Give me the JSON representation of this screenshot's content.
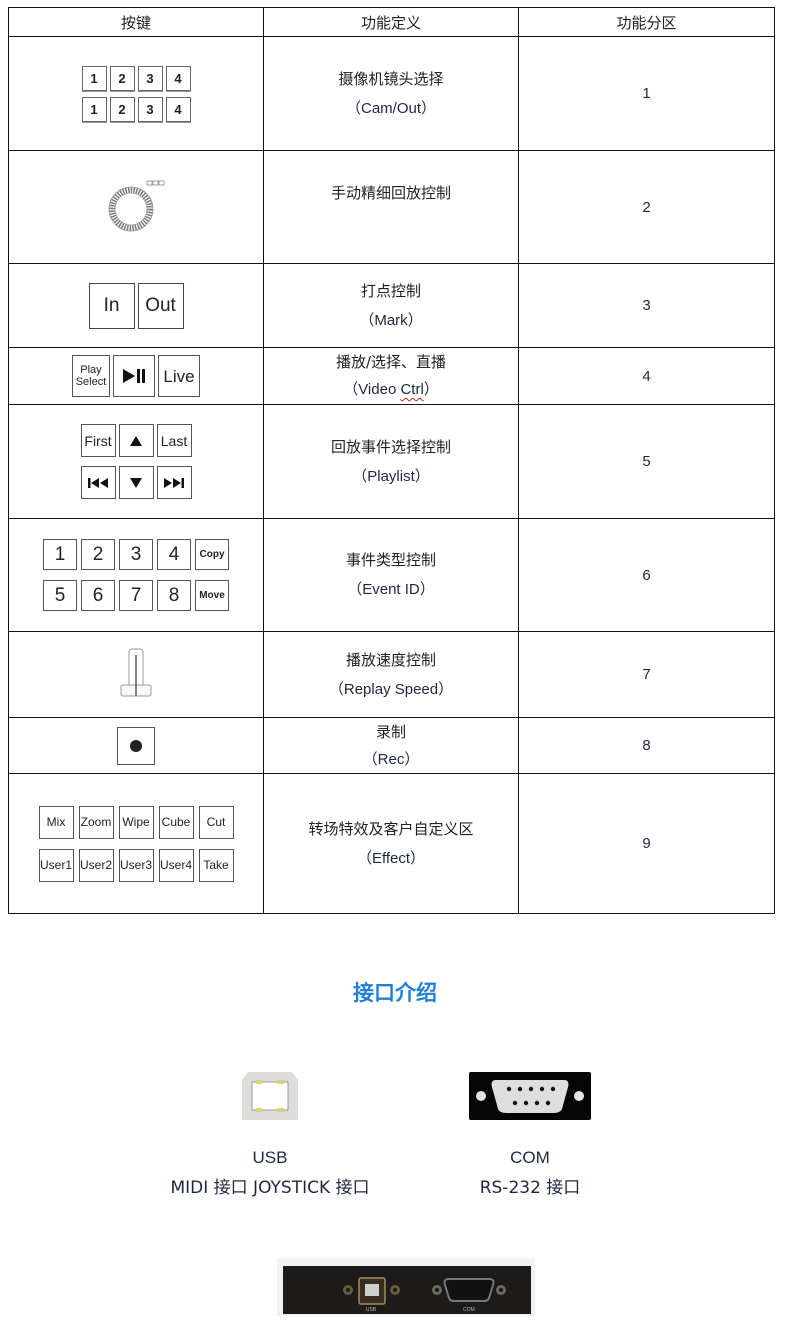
{
  "table": {
    "headers": [
      "按键",
      "功能定义",
      "功能分区"
    ],
    "rows": [
      {
        "keys_label": "Cam/Out key grid",
        "keys": [
          [
            "1",
            "2",
            "3",
            "4"
          ],
          [
            "1",
            "2",
            "3",
            "4"
          ]
        ],
        "func_cn": "摄像机镜头选择",
        "func_en": "（Cam/Out）",
        "zone": "1"
      },
      {
        "keys_label": "jog-shuttle wheel",
        "func_cn": "手动精细回放控制",
        "func_en": "",
        "zone": "2"
      },
      {
        "keys_label": "mark keys",
        "keys": [
          [
            "In",
            "Out"
          ]
        ],
        "func_cn": "打点控制",
        "func_en": "（Mark）",
        "zone": "3"
      },
      {
        "keys_label": "video control keys",
        "keys": [
          [
            "Play Select",
            "▶II",
            "Live"
          ]
        ],
        "func_cn": "播放/选择、直播",
        "func_en_pre": "（Video ",
        "func_en_wavy": "Ctrl",
        "func_en_post": "）",
        "zone": "4"
      },
      {
        "keys_label": "playlist keys",
        "keys": [
          [
            "First",
            "▲",
            "Last"
          ],
          [
            "|◀◀",
            "▼",
            "▶▶|"
          ]
        ],
        "func_cn": "回放事件选择控制",
        "func_en": "（Playlist）",
        "zone": "5"
      },
      {
        "keys_label": "event id keys",
        "keys": [
          [
            "1",
            "2",
            "3",
            "4",
            "Copy"
          ],
          [
            "5",
            "6",
            "7",
            "8",
            "Move"
          ]
        ],
        "func_cn": "事件类型控制",
        "func_en": "（Event ID）",
        "zone": "6"
      },
      {
        "keys_label": "replay speed fader",
        "func_cn": "播放速度控制",
        "func_en": "（Replay Speed）",
        "zone": "7"
      },
      {
        "keys_label": "record key",
        "func_cn": "录制",
        "func_en": "（Rec）",
        "zone": "8"
      },
      {
        "keys_label": "effect keys",
        "keys": [
          [
            "Mix",
            "Zoom",
            "Wipe",
            "Cube",
            "Cut"
          ],
          [
            "User1",
            "User2",
            "User3",
            "User4",
            "Take"
          ]
        ],
        "func_cn": "转场特效及客户自定义区",
        "func_en": "（Effect）",
        "zone": "9"
      }
    ]
  },
  "interfaces": {
    "title": "接口介绍",
    "title_color": "#1f7fd6",
    "usb": {
      "line1": "USB",
      "line2": "MIDI 接口 JOYSTICK 接口",
      "icon": "usb-b-port-icon"
    },
    "com": {
      "line1": "COM",
      "line2": "RS-232 接口",
      "icon": "db9-serial-port-icon"
    },
    "panel": {
      "usb_label": "USB",
      "com_label": "COM"
    }
  }
}
